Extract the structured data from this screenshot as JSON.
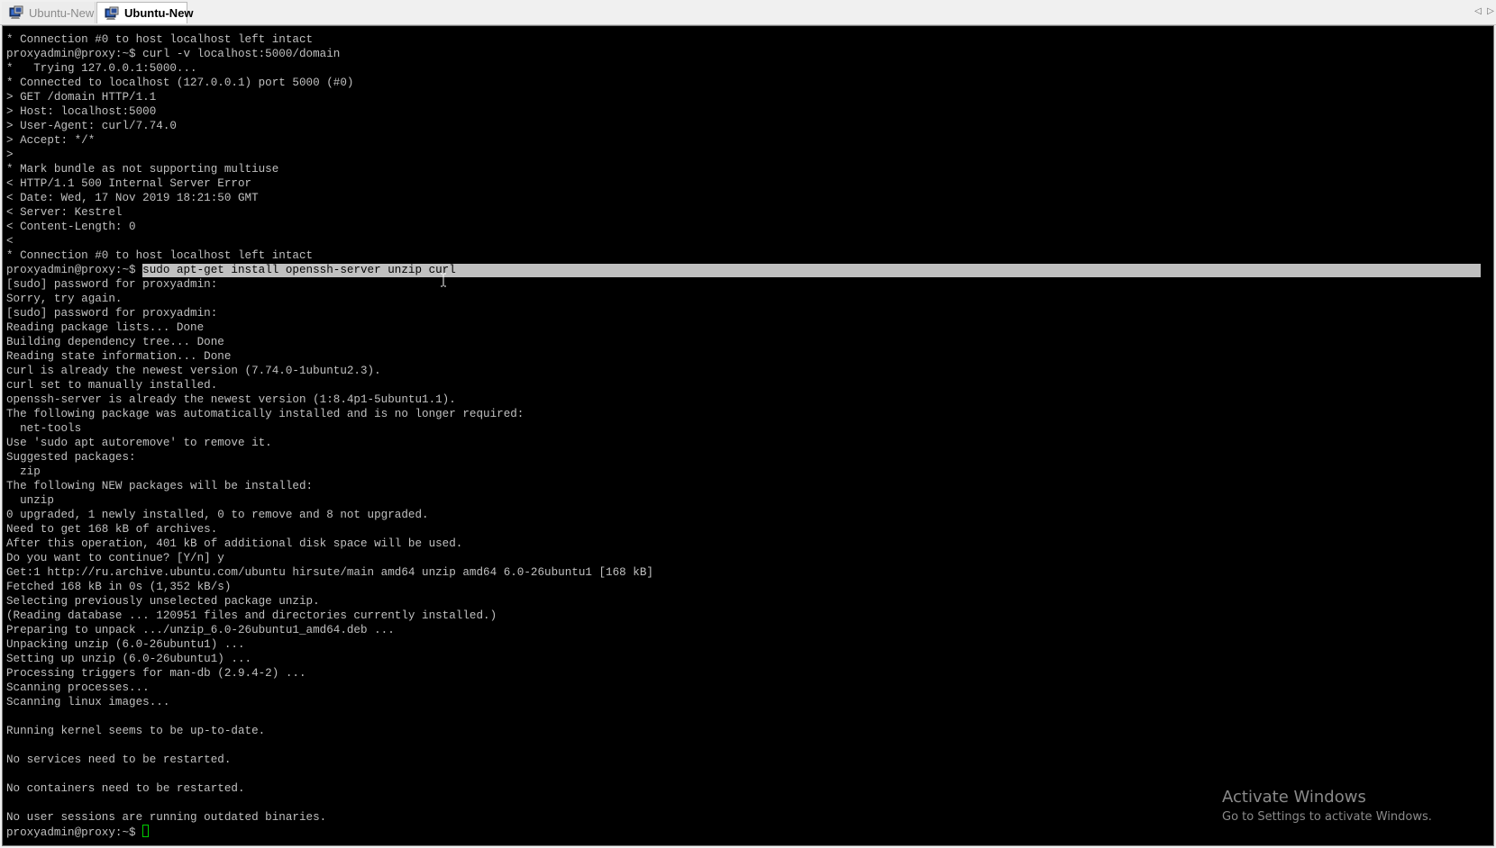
{
  "tabs": [
    {
      "label": "Ubuntu-New",
      "active": false
    },
    {
      "label": "Ubuntu-New",
      "active": true
    }
  ],
  "tab_scroll": {
    "left": "◁",
    "right": "▷"
  },
  "terminal": {
    "lines_before": [
      "* Connection #0 to host localhost left intact",
      "proxyadmin@proxy:~$ curl -v localhost:5000/domain",
      "*   Trying 127.0.0.1:5000...",
      "* Connected to localhost (127.0.0.1) port 5000 (#0)",
      "> GET /domain HTTP/1.1",
      "> Host: localhost:5000",
      "> User-Agent: curl/7.74.0",
      "> Accept: */*",
      ">",
      "* Mark bundle as not supporting multiuse",
      "< HTTP/1.1 500 Internal Server Error",
      "< Date: Wed, 17 Nov 2019 18:21:50 GMT",
      "< Server: Kestrel",
      "< Content-Length: 0",
      "<",
      "* Connection #0 to host localhost left intact"
    ],
    "selected_line": {
      "prompt": "proxyadmin@proxy:~$ ",
      "command": "sudo apt-get install openssh-server unzip curl"
    },
    "lines_after": [
      "[sudo] password for proxyadmin:",
      "Sorry, try again.",
      "[sudo] password for proxyadmin:",
      "Reading package lists... Done",
      "Building dependency tree... Done",
      "Reading state information... Done",
      "curl is already the newest version (7.74.0-1ubuntu2.3).",
      "curl set to manually installed.",
      "openssh-server is already the newest version (1:8.4p1-5ubuntu1.1).",
      "The following package was automatically installed and is no longer required:",
      "  net-tools",
      "Use 'sudo apt autoremove' to remove it.",
      "Suggested packages:",
      "  zip",
      "The following NEW packages will be installed:",
      "  unzip",
      "0 upgraded, 1 newly installed, 0 to remove and 8 not upgraded.",
      "Need to get 168 kB of archives.",
      "After this operation, 401 kB of additional disk space will be used.",
      "Do you want to continue? [Y/n] y",
      "Get:1 http://ru.archive.ubuntu.com/ubuntu hirsute/main amd64 unzip amd64 6.0-26ubuntu1 [168 kB]",
      "Fetched 168 kB in 0s (1,352 kB/s)",
      "Selecting previously unselected package unzip.",
      "(Reading database ... 120951 files and directories currently installed.)",
      "Preparing to unpack .../unzip_6.0-26ubuntu1_amd64.deb ...",
      "Unpacking unzip (6.0-26ubuntu1) ...",
      "Setting up unzip (6.0-26ubuntu1) ...",
      "Processing triggers for man-db (2.9.4-2) ...",
      "Scanning processes...",
      "Scanning linux images...",
      "",
      "Running kernel seems to be up-to-date.",
      "",
      "No services need to be restarted.",
      "",
      "No containers need to be restarted.",
      "",
      "No user sessions are running outdated binaries."
    ],
    "final_prompt": "proxyadmin@proxy:~$ "
  },
  "watermark": {
    "title": "Activate Windows",
    "subtitle": "Go to Settings to activate Windows."
  },
  "colors": {
    "terminal_bg": "#000000",
    "terminal_fg": "#c0c0c0",
    "selection_bg": "#c0c0c0",
    "cursor": "#00d000"
  },
  "icons": {
    "tab_icon": "putty-terminal-icon",
    "cursor": "text-ibeam-cursor-icon"
  }
}
